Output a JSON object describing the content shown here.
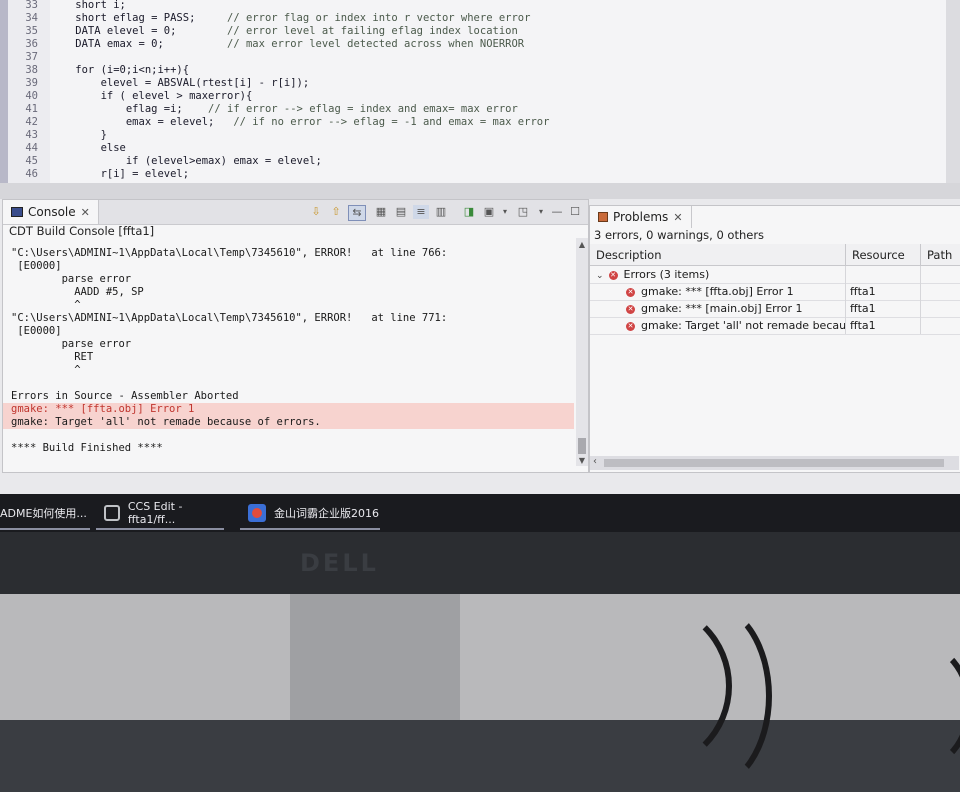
{
  "editor": {
    "lines": [
      {
        "n": "33",
        "code": "    short i;",
        "comment": ""
      },
      {
        "n": "34",
        "code": "    short eflag = PASS;     ",
        "comment": "// error flag or index into r vector where error"
      },
      {
        "n": "35",
        "code": "    DATA elevel = 0;        ",
        "comment": "// error level at failing eflag index location"
      },
      {
        "n": "36",
        "code": "    DATA emax = 0;          ",
        "comment": "// max error level detected across when NOERROR"
      },
      {
        "n": "37",
        "code": "",
        "comment": ""
      },
      {
        "n": "38",
        "code": "    for (i=0;i<n;i++){",
        "comment": ""
      },
      {
        "n": "39",
        "code": "        elevel = ABSVAL(rtest[i] - r[i]);",
        "comment": ""
      },
      {
        "n": "40",
        "code": "        if ( elevel > maxerror){",
        "comment": ""
      },
      {
        "n": "41",
        "code": "            eflag =i;    ",
        "comment": "// if error --> eflag = index and emax= max error"
      },
      {
        "n": "42",
        "code": "            emax = elevel;   ",
        "comment": "// if no error --> eflag = -1 and emax = max error"
      },
      {
        "n": "43",
        "code": "        }",
        "comment": ""
      },
      {
        "n": "44",
        "code": "        else",
        "comment": ""
      },
      {
        "n": "45",
        "code": "            if (elevel>emax) emax = elevel;",
        "comment": ""
      },
      {
        "n": "46",
        "code": "        r[i] = elevel;",
        "comment": ""
      }
    ]
  },
  "console": {
    "tab_label": "Console",
    "close_glyph": "✕",
    "subtitle": "CDT Build Console [ffta1]",
    "lines": [
      {
        "text": "         ^",
        "kind": "normal"
      },
      {
        "text": "\"C:\\Users\\ADMINI~1\\AppData\\Local\\Temp\\7345610\", ERROR!   at line 766:",
        "kind": "normal"
      },
      {
        "text": " [E0000]",
        "kind": "normal"
      },
      {
        "text": "        parse error",
        "kind": "normal"
      },
      {
        "text": "          AADD #5, SP",
        "kind": "normal"
      },
      {
        "text": "          ^",
        "kind": "normal"
      },
      {
        "text": "\"C:\\Users\\ADMINI~1\\AppData\\Local\\Temp\\7345610\", ERROR!   at line 771:",
        "kind": "normal"
      },
      {
        "text": " [E0000]",
        "kind": "normal"
      },
      {
        "text": "        parse error",
        "kind": "normal"
      },
      {
        "text": "          RET",
        "kind": "normal"
      },
      {
        "text": "          ^",
        "kind": "normal"
      },
      {
        "text": "",
        "kind": "normal"
      },
      {
        "text": "Errors in Source - Assembler Aborted",
        "kind": "normal"
      },
      {
        "text": "gmake: *** [ffta.obj] Error 1",
        "kind": "error"
      },
      {
        "text": "gmake: Target 'all' not remade because of errors.",
        "kind": "highlight"
      },
      {
        "text": "",
        "kind": "normal"
      },
      {
        "text": "**** Build Finished ****",
        "kind": "normal"
      }
    ]
  },
  "problems": {
    "tab_label": "Problems",
    "close_glyph": "✕",
    "summary": "3 errors, 0 warnings, 0 others",
    "columns": {
      "description": "Description",
      "resource": "Resource",
      "path": "Path"
    },
    "group_label": "Errors (3 items)",
    "rows": [
      {
        "description": "gmake: *** [ffta.obj] Error 1",
        "resource": "ffta1"
      },
      {
        "description": "gmake: *** [main.obj] Error 1",
        "resource": "ffta1"
      },
      {
        "description": "gmake: Target 'all' not remade because",
        "resource": "ffta1"
      }
    ]
  },
  "taskbar": {
    "items": [
      {
        "label": "ADME如何使用..."
      },
      {
        "label": "CCS Edit - ffta1/ff..."
      },
      {
        "label": "金山词霸企业版2016"
      }
    ]
  },
  "monitor": {
    "brand": "DELL"
  },
  "colors": {
    "error_text": "#c0362f",
    "error_highlight": "#f7d3cf",
    "error_icon": "#d04444"
  }
}
